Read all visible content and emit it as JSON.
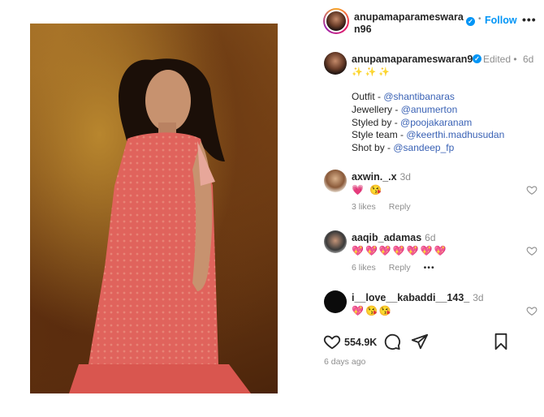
{
  "post": {
    "username": "anupamaparameswaran96",
    "follow_label": "Follow",
    "more_label": "•••",
    "dot": "•"
  },
  "caption": {
    "username": "anupamaparameswaran96",
    "edited": "Edited •",
    "time": "6d",
    "sparkles": "✨✨✨",
    "lines": [
      {
        "label": "Outfit - ",
        "mention": "@shantibanaras"
      },
      {
        "label": "Jewellery - ",
        "mention": "@anumerton"
      },
      {
        "label": "Styled by - ",
        "mention": "@poojakaranam"
      },
      {
        "label": "Style team - ",
        "mention": "@keerthi.madhusudan"
      },
      {
        "label": "Shot by - ",
        "mention": "@sandeep_fp"
      }
    ]
  },
  "comments": [
    {
      "username": "axwin._.x",
      "time": "3d",
      "emoji": "💗 😘",
      "likes": "3 likes",
      "reply": "Reply",
      "more": ""
    },
    {
      "username": "aaqib_adamas",
      "time": "6d",
      "emoji": "💖💖💖💖💖💖💖",
      "likes": "6 likes",
      "reply": "Reply",
      "more": "•••"
    },
    {
      "username": "i__love__kabaddi__143_",
      "time": "3d",
      "emoji": "💖😘😘",
      "likes": "",
      "reply": "",
      "more": ""
    }
  ],
  "actions": {
    "likes": "554.9K",
    "posted": "6 days ago"
  },
  "icons": [
    "heart-icon",
    "comment-icon",
    "share-icon",
    "bookmark-icon",
    "verified-icon",
    "more-icon"
  ],
  "colors": {
    "accent": "#0095f6",
    "mention": "#3a62b5",
    "muted": "#8e8e8e",
    "dress": "#e0635c"
  }
}
